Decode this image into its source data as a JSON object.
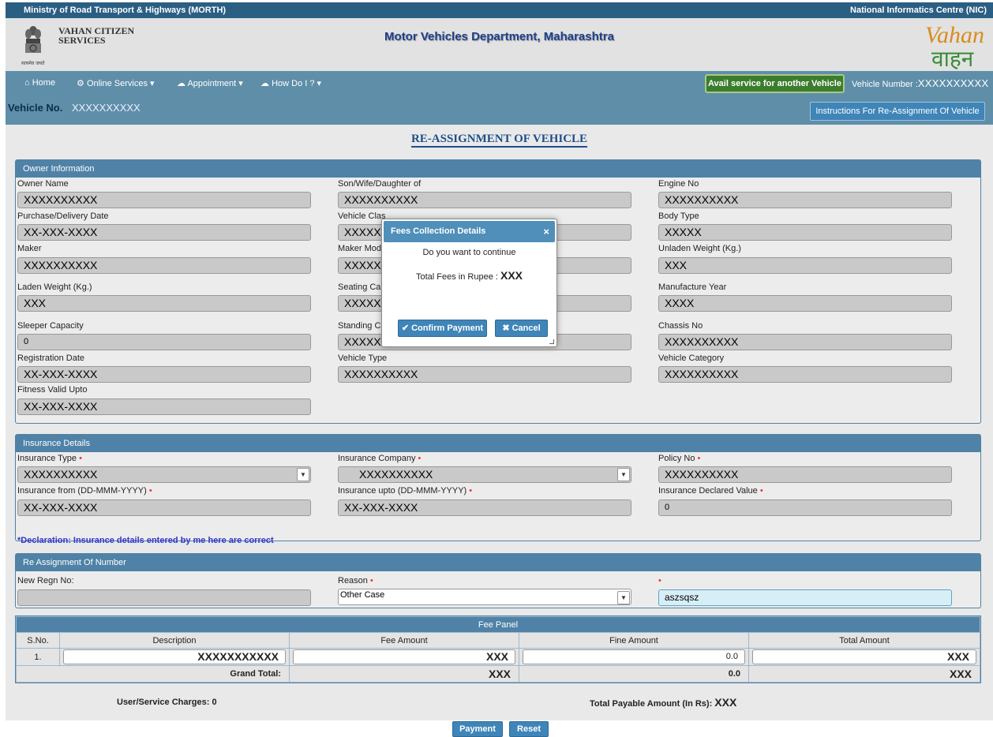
{
  "header": {
    "ministry": "Ministry of Road Transport & Highways (MORTH)",
    "nic": "National Informatics Centre (NIC)",
    "citizen_services": "VAHAN CITIZEN SERVICES",
    "department": "Motor Vehicles Department, Maharashtra",
    "emblem_caption": "सत्यमेव जयते",
    "logo_text_en": "Vahan",
    "logo_text_hi": "वाहन"
  },
  "nav": {
    "home": "Home",
    "online_services": "Online Services",
    "appointment": "Appointment",
    "how_do_i": "How Do I ?",
    "avail_service": "Avail service for another Vehicle",
    "vehicle_number_label": "Vehicle Number :",
    "vehicle_number_value": "XXXXXXXXXX"
  },
  "vehicle_bar": {
    "label": "Vehicle No.",
    "value": "XXXXXXXXXX",
    "instructions_button": "Instructions For Re-Assignment Of Vehicle"
  },
  "page_title": "RE-ASSIGNMENT OF VEHICLE",
  "owner": {
    "heading": "Owner Information",
    "fields": {
      "owner_name": {
        "label": "Owner Name",
        "value": "XXXXXXXXXX"
      },
      "son_wife": {
        "label": "Son/Wife/Daughter of",
        "value": "XXXXXXXXXX"
      },
      "engine_no": {
        "label": "Engine No",
        "value": "XXXXXXXXXX"
      },
      "purchase_date": {
        "label": "Purchase/Delivery Date",
        "value": "XX-XXX-XXXX"
      },
      "vehicle_class": {
        "label": "Vehicle Clas",
        "value": "XXXXX"
      },
      "body_type": {
        "label": "Body Type",
        "value": "XXXXX"
      },
      "maker": {
        "label": "Maker",
        "value": "XXXXXXXXXX"
      },
      "maker_model": {
        "label": "Maker Mode",
        "value": "XXXXX"
      },
      "unladen_weight": {
        "label": "Unladen Weight (Kg.)",
        "value": "XXX"
      },
      "laden_weight": {
        "label": "Laden Weight (Kg.)",
        "value": "XXX"
      },
      "seating_cap": {
        "label": "Seating Cap",
        "value": "XXXXX"
      },
      "manufacture_year": {
        "label": "Manufacture Year",
        "value": "XXXX"
      },
      "sleeper_capacity": {
        "label": "Sleeper Capacity",
        "value": "0"
      },
      "standing_cap": {
        "label": "Standing Ca",
        "value": "XXXXX"
      },
      "chassis_no": {
        "label": "Chassis No",
        "value": "XXXXXXXXXX"
      },
      "registration_date": {
        "label": "Registration Date",
        "value": "XX-XXX-XXXX"
      },
      "vehicle_type": {
        "label": "Vehicle Type",
        "value": "XXXXXXXXXX"
      },
      "vehicle_category": {
        "label": "Vehicle Category",
        "value": "XXXXXXXXXX"
      },
      "fitness_valid": {
        "label": "Fitness Valid Upto",
        "value": "XX-XXX-XXXX"
      }
    }
  },
  "insurance": {
    "heading": "Insurance Details",
    "type_label": "Insurance Type",
    "type_value": "XXXXXXXXXX",
    "company_label": "Insurance Company",
    "company_value": "XXXXXXXXXX",
    "policy_label": "Policy No",
    "policy_value": "XXXXXXXXXX",
    "from_label": "Insurance from (DD-MMM-YYYY)",
    "from_value": "XX-XXX-XXXX",
    "upto_label": "Insurance upto (DD-MMM-YYYY)",
    "upto_value": "XX-XXX-XXXX",
    "declared_label": "Insurance Declared Value",
    "declared_value": "0",
    "declaration": "*Declaration: Insurance details entered by me here are correct",
    "required_mark": "•"
  },
  "reassign": {
    "heading": "Re Assignment Of Number",
    "new_regn_label": "New Regn No:",
    "new_regn_value": "",
    "reason_label": "Reason",
    "reason_value": "Other Case",
    "extra_value": "aszsqsz"
  },
  "fee_panel": {
    "heading": "Fee Panel",
    "columns": [
      "S.No.",
      "Description",
      "Fee Amount",
      "Fine Amount",
      "Total Amount"
    ],
    "row": {
      "sno": "1.",
      "description": "XXXXXXXXXXX",
      "fee": "XXX",
      "fine": "0.0",
      "total": "XXX"
    },
    "grand_total_label": "Grand Total:",
    "grand_fee": "XXX",
    "grand_fine": "0.0",
    "grand_total": "XXX"
  },
  "summary": {
    "user_charges": "User/Service Charges: 0",
    "payable_label": "Total Payable Amount (In Rs):",
    "payable_value": "XXX"
  },
  "actions": {
    "payment": "Payment",
    "reset": "Reset"
  },
  "dialog": {
    "title": "Fees Collection Details",
    "close": "×",
    "question": "Do you want to continue",
    "fees_label": "Total Fees in Rupee :",
    "fees_value": "XXX",
    "confirm": "Confirm Payment",
    "cancel": "Cancel"
  },
  "colors": {
    "brand_blue": "#2b5e83",
    "nav_blue": "#5f8ea9",
    "panel_blue": "#4f82a6",
    "avail_green": "#3c7d2d"
  }
}
